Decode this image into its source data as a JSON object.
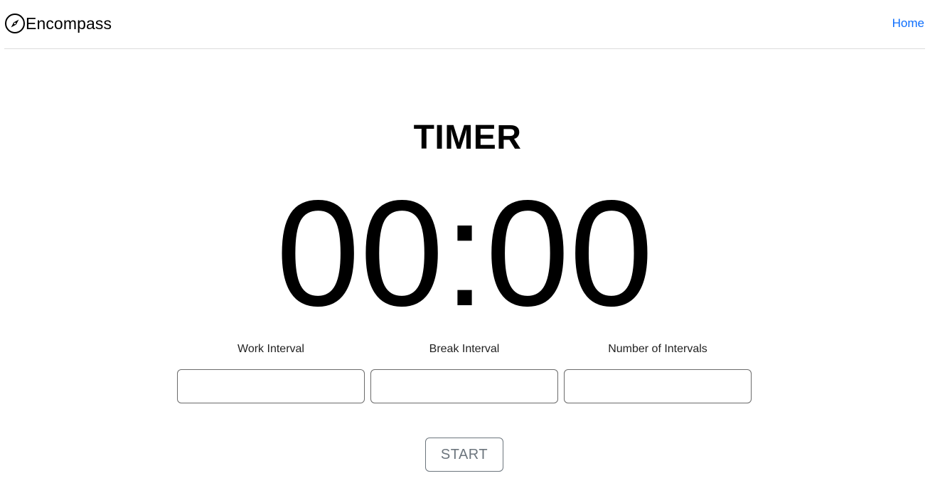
{
  "navbar": {
    "brand_name": "Encompass",
    "brand_icon": "compass-icon",
    "links": [
      {
        "label": "Home"
      }
    ]
  },
  "timer": {
    "heading": "TIMER",
    "display": "00:00"
  },
  "fields": [
    {
      "label": "Work Interval",
      "value": "",
      "placeholder": ""
    },
    {
      "label": "Break Interval",
      "value": "",
      "placeholder": ""
    },
    {
      "label": "Number of Intervals",
      "value": "",
      "placeholder": ""
    }
  ],
  "actions": {
    "start_label": "START"
  },
  "colors": {
    "link": "#0d6efd",
    "button_outline": "#6c757d",
    "input_border": "#6b6b6b",
    "divider": "#dcdcdc"
  }
}
